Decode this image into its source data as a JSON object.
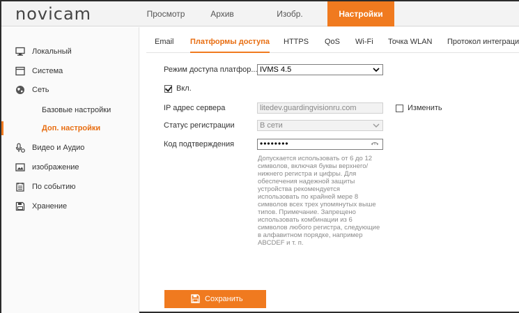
{
  "logo": "novicam",
  "topnav": [
    {
      "label": "Просмотр"
    },
    {
      "label": "Архив"
    },
    {
      "label": "Изобр."
    },
    {
      "label": "Настройки"
    }
  ],
  "sidebar": {
    "items": [
      {
        "label": "Локальный",
        "icon": "monitor-icon"
      },
      {
        "label": "Система",
        "icon": "system-icon"
      },
      {
        "label": "Сеть",
        "icon": "globe-icon"
      },
      {
        "label": "Базовые настройки"
      },
      {
        "label": "Доп. настройки"
      },
      {
        "label": "Видео и Аудио",
        "icon": "video-audio-icon"
      },
      {
        "label": "изображение",
        "icon": "image-icon"
      },
      {
        "label": "По событию",
        "icon": "event-icon"
      },
      {
        "label": "Хранение",
        "icon": "storage-icon"
      }
    ]
  },
  "subtabs": [
    {
      "label": "Email"
    },
    {
      "label": "Платформы доступа"
    },
    {
      "label": "HTTPS"
    },
    {
      "label": "QoS"
    },
    {
      "label": "Wi-Fi"
    },
    {
      "label": "Точка WLAN"
    },
    {
      "label": "Протокол интеграци"
    }
  ],
  "form": {
    "access_mode_label": "Режим доступа платфор...",
    "access_mode_value": "IVMS 4.5",
    "enable_label": "Вкл.",
    "enable_checked": true,
    "server_ip_label": "IP адрес сервера",
    "server_ip_value": "litedev.guardingvisionru.com",
    "change_label": "Изменить",
    "change_checked": false,
    "reg_status_label": "Статус регистрации",
    "reg_status_value": "В сети",
    "verify_code_label": "Код подтверждения",
    "verify_code_value": "••••••••",
    "hint": "Допускается использовать от 6 до 12 символов, включая буквы верхнего/нижнего регистра и цифры. Для обеспечения надежной защиты устройства рекомендуется использовать по крайней мере 8 символов всех трех упомянутых выше типов. Примечание. Запрещено использовать комбинации из 6 символов любого регистра, следующие в алфавитном порядке, например ABCDEF и т. п."
  },
  "save_label": "Сохранить",
  "colors": {
    "accent": "#f07a1f",
    "active_text": "#e86e12"
  }
}
